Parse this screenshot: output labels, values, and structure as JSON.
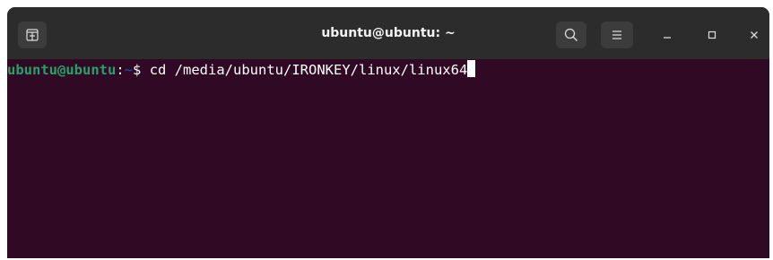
{
  "window": {
    "title": "ubuntu@ubuntu: ~"
  },
  "titlebar": {
    "new_tab_icon": "new-tab-icon",
    "search_icon": "search-icon",
    "menu_icon": "hamburger-menu-icon",
    "minimize_icon": "minimize-icon",
    "maximize_icon": "maximize-icon",
    "close_icon": "close-icon"
  },
  "terminal": {
    "prompt_user": "ubuntu@ubuntu",
    "prompt_separator": ":",
    "prompt_path": "~",
    "prompt_symbol": "$ ",
    "command": "cd /media/ubuntu/IRONKEY/linux/linux64"
  },
  "colors": {
    "terminal_background": "#300a24",
    "titlebar_background": "#2c2c2c",
    "prompt_user": "#26a269",
    "prompt_path": "#12488b",
    "text": "#ffffff"
  }
}
